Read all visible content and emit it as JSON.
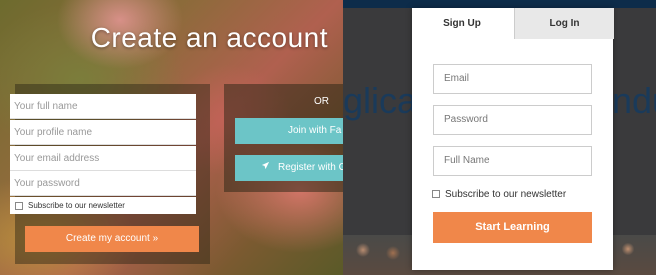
{
  "left_form": {
    "title": "Create an account",
    "fields": [
      {
        "placeholder": "Your full name"
      },
      {
        "placeholder": "Your profile name"
      },
      {
        "placeholder": "Your email address"
      },
      {
        "placeholder": "Your password"
      }
    ],
    "newsletter_label": "Subscribe to our newsletter",
    "submit_label": "Create my account »",
    "or_label": "OR",
    "facebook_label": "Join with Fa",
    "google_label": "Register with G"
  },
  "right_form": {
    "tabs": [
      {
        "label": "Sign Up",
        "active": true
      },
      {
        "label": "Log In",
        "active": false
      }
    ],
    "fields": [
      {
        "placeholder": "Email"
      },
      {
        "placeholder": "Password"
      },
      {
        "placeholder": "Full Name"
      }
    ],
    "newsletter_label": "Subscribe to our newsletter",
    "submit_label": "Start Learning",
    "background_text_left": "glican",
    "background_text_right": "ndu"
  },
  "colors": {
    "accent_orange": "#f0874a",
    "social_teal": "#6cc5c7",
    "top_bar_navy": "#0d2c4a"
  },
  "icons": {
    "register_icon": "paper-plane-icon"
  }
}
